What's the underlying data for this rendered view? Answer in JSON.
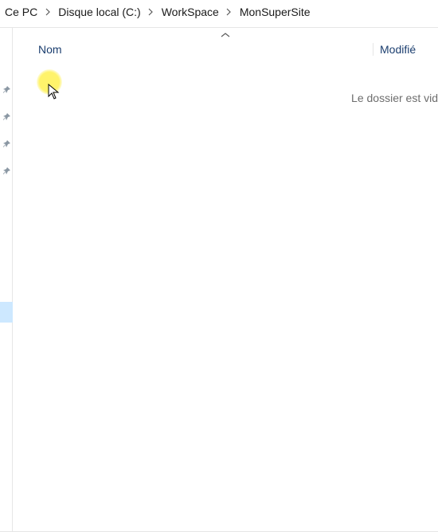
{
  "breadcrumb": {
    "items": [
      {
        "label": "Ce PC"
      },
      {
        "label": "Disque local (C:)"
      },
      {
        "label": "WorkSpace"
      },
      {
        "label": "MonSuperSite"
      }
    ]
  },
  "columns": {
    "name_label": "Nom",
    "modified_label": "Modifié"
  },
  "content": {
    "empty_message": "Le dossier est vid"
  },
  "colors": {
    "header_text": "#1b3e6f",
    "muted_text": "#6d6d6d",
    "highlight_selection": "#cde8ff",
    "cursor_highlight": "#fff36b"
  }
}
